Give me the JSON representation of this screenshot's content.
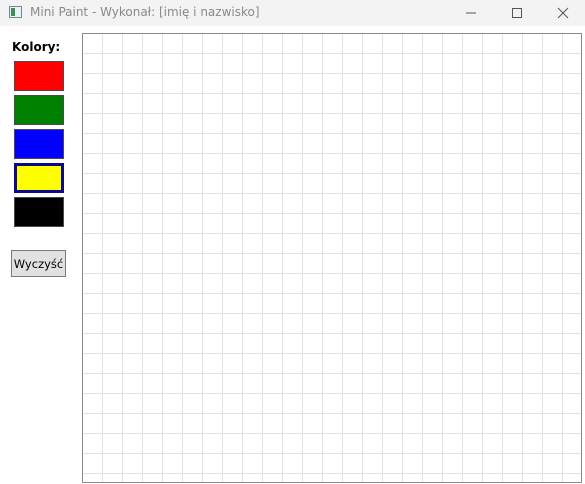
{
  "window": {
    "title": "Mini Paint - Wykonał: [imię i nazwisko]",
    "icon": "app-icon"
  },
  "sidebar": {
    "colors_label": "Kolory:",
    "colors": [
      {
        "name": "red",
        "hex": "#ff0000",
        "selected": false
      },
      {
        "name": "green",
        "hex": "#008000",
        "selected": false
      },
      {
        "name": "blue",
        "hex": "#0000ff",
        "selected": false
      },
      {
        "name": "yellow",
        "hex": "#ffff00",
        "selected": true
      },
      {
        "name": "black",
        "hex": "#000000",
        "selected": false
      }
    ],
    "clear_label": "Wyczyść"
  },
  "canvas": {
    "background": "#ffffff",
    "grid_color": "#e2e2e2"
  }
}
